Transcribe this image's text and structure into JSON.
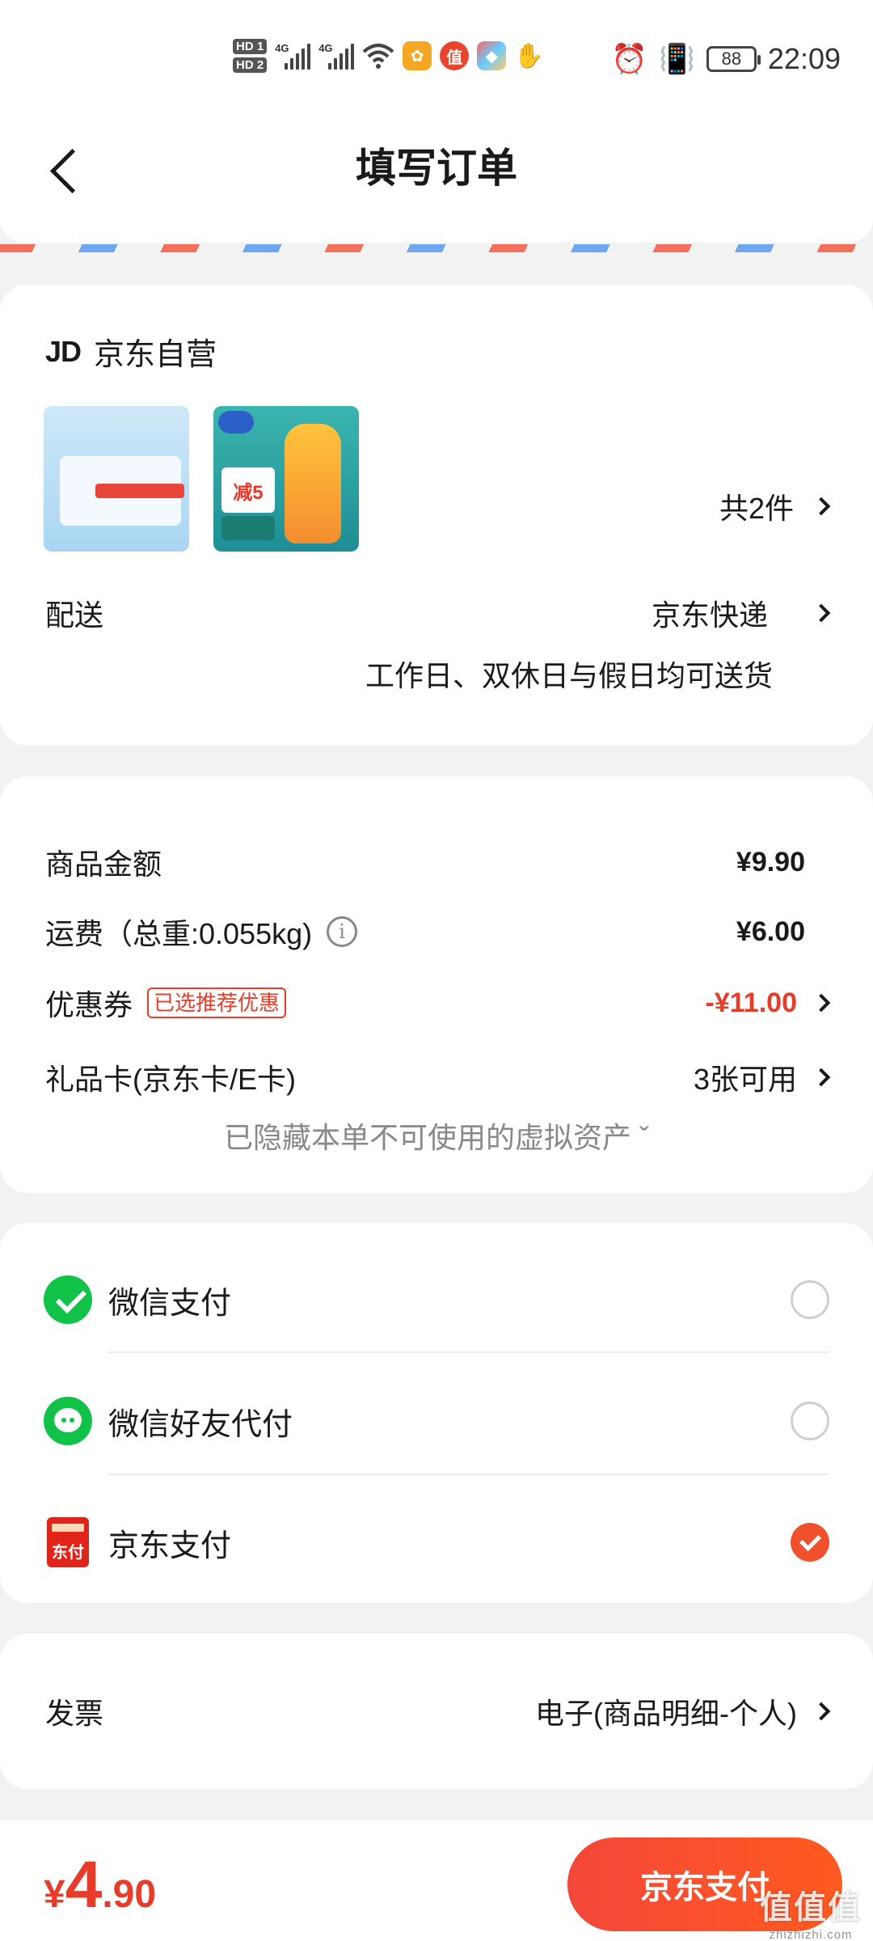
{
  "status_bar": {
    "hd1": "HD 1",
    "hd2": "HD 2",
    "net1": "4G",
    "net2": "4G",
    "app_zhi": "值",
    "battery": "88",
    "time": "22:09"
  },
  "header": {
    "title": "填写订单"
  },
  "shop": {
    "logo": "JD",
    "name": "京东自营",
    "item_count": "共2件",
    "thumb_tag": "减5"
  },
  "delivery": {
    "label": "配送",
    "method": "京东快递",
    "note": "工作日、双休日与假日均可送货"
  },
  "costs": {
    "goods_label": "商品金额",
    "goods_value": "¥9.90",
    "shipping_label": "运费（总重:0.055kg)",
    "shipping_value": "¥6.00",
    "coupon_label": "优惠券",
    "coupon_tag": "已选推荐优惠",
    "coupon_value": "-¥11.00",
    "giftcard_label": "礼品卡(京东卡/E卡)",
    "giftcard_value": "3张可用",
    "hidden_note": "已隐藏本单不可使用的虚拟资产 ˇ"
  },
  "payment": {
    "options": [
      {
        "name": "微信支付",
        "selected": false
      },
      {
        "name": "微信好友代付",
        "selected": false
      },
      {
        "name": "京东支付",
        "selected": true
      }
    ],
    "jd_icon_text": "东付"
  },
  "invoice": {
    "label": "发票",
    "value": "电子(商品明细-个人)"
  },
  "bottom": {
    "currency": "¥",
    "total_int": "4",
    "total_dec": ".90",
    "pay_button": "京东支付",
    "watermark": "值值值",
    "watermark_site": "zhizhizhi.com"
  },
  "colors": {
    "accent_red": "#e83c2b",
    "wechat_green": "#10c247",
    "jd_red": "#e2231a"
  }
}
